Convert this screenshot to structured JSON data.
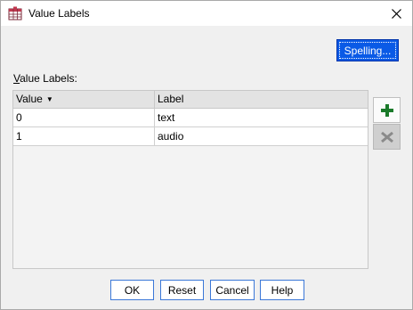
{
  "window": {
    "title": "Value Labels",
    "icon": "spss-app-icon",
    "close_icon": "close-icon"
  },
  "spelling_button": "Spelling...",
  "value_labels_caption": {
    "mnemonic": "V",
    "rest": "alue Labels:"
  },
  "grid": {
    "columns": [
      "Value",
      "Label"
    ],
    "sort_icon": "sort-desc-icon",
    "rows": [
      {
        "value": "0",
        "label": "text"
      },
      {
        "value": "1",
        "label": "audio"
      }
    ]
  },
  "side_buttons": {
    "add_icon": "plus-icon",
    "delete_icon": "x-icon",
    "delete_enabled": false
  },
  "buttons": {
    "ok": "OK",
    "reset": "Reset",
    "cancel": "Cancel",
    "help": "Help"
  },
  "colors": {
    "accent": "#0a5ae6",
    "add_icon": "#1a7a2a"
  }
}
